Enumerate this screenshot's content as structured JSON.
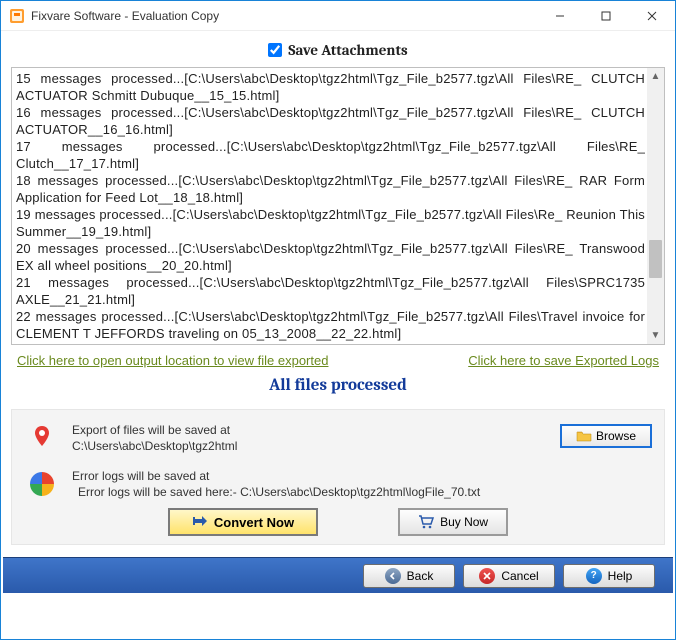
{
  "window": {
    "title": "Fixvare Software - Evaluation Copy"
  },
  "checkbox": {
    "label": "Save Attachments",
    "checked": true
  },
  "log": {
    "lines": [
      "15 messages processed...[C:\\Users\\abc\\Desktop\\tgz2html\\Tgz_File_b2577.tgz\\All Files\\RE_ CLUTCH ACTUATOR Schmitt Dubuque__15_15.html]",
      "16 messages processed...[C:\\Users\\abc\\Desktop\\tgz2html\\Tgz_File_b2577.tgz\\All Files\\RE_ CLUTCH ACTUATOR__16_16.html]",
      "17 messages processed...[C:\\Users\\abc\\Desktop\\tgz2html\\Tgz_File_b2577.tgz\\All Files\\RE_ Clutch__17_17.html]",
      "18 messages processed...[C:\\Users\\abc\\Desktop\\tgz2html\\Tgz_File_b2577.tgz\\All Files\\RE_ RAR Form Application for Feed Lot__18_18.html]",
      "19 messages processed...[C:\\Users\\abc\\Desktop\\tgz2html\\Tgz_File_b2577.tgz\\All Files\\Re_ Reunion This Summer__19_19.html]",
      "20 messages processed...[C:\\Users\\abc\\Desktop\\tgz2html\\Tgz_File_b2577.tgz\\All Files\\RE_ Transwood EX all wheel positions__20_20.html]",
      "21 messages processed...[C:\\Users\\abc\\Desktop\\tgz2html\\Tgz_File_b2577.tgz\\All Files\\SPRC1735 AXLE__21_21.html]",
      "22 messages processed...[C:\\Users\\abc\\Desktop\\tgz2html\\Tgz_File_b2577.tgz\\All Files\\Travel invoice for CLEMENT T JEFFORDS traveling on 05_13_2008__22_22.html]"
    ]
  },
  "links": {
    "open_output": "Click here to open output location to view file exported",
    "save_logs": "Click here to save Exported Logs"
  },
  "status": "All files processed",
  "panel": {
    "export_label": "Export of files will be saved at",
    "export_path": "C:\\Users\\abc\\Desktop\\tgz2html",
    "browse_label": "Browse",
    "error_label": "Error logs will be saved at",
    "error_path": "Error logs will be saved here:- C:\\Users\\abc\\Desktop\\tgz2html\\logFile_70.txt",
    "convert_label": "Convert Now",
    "buy_label": "Buy Now"
  },
  "footer": {
    "back": "Back",
    "cancel": "Cancel",
    "help": "Help"
  }
}
